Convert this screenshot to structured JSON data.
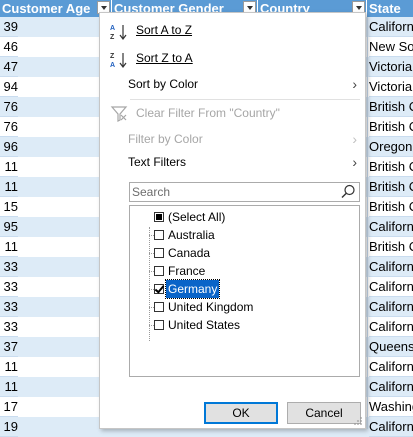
{
  "headers": {
    "customer_age": "Customer Age",
    "customer_gender": "Customer Gender",
    "country": "Country",
    "state": "State"
  },
  "rows": [
    {
      "age": "39",
      "state": "California"
    },
    {
      "age": "46",
      "state": "New South Wales"
    },
    {
      "age": "47",
      "state": "Victoria"
    },
    {
      "age": "94",
      "state": "Victoria"
    },
    {
      "age": "76",
      "state": "British Columbia"
    },
    {
      "age": "76",
      "state": "British Columbia"
    },
    {
      "age": "96",
      "state": "Oregon"
    },
    {
      "age": "11",
      "state": "British Columbia"
    },
    {
      "age": "11",
      "state": "British Columbia"
    },
    {
      "age": "15",
      "state": "British Columbia"
    },
    {
      "age": "95",
      "state": "California"
    },
    {
      "age": "11",
      "state": "British Columbia"
    },
    {
      "age": "33",
      "state": "California"
    },
    {
      "age": "33",
      "state": "California"
    },
    {
      "age": "33",
      "state": "California"
    },
    {
      "age": "33",
      "state": "California"
    },
    {
      "age": "37",
      "state": "Queensland"
    },
    {
      "age": "11",
      "state": "California"
    },
    {
      "age": "11",
      "state": "California"
    },
    {
      "age": "17",
      "state": "Washington"
    },
    {
      "age": "19",
      "state": "California"
    }
  ],
  "menu": {
    "sort_az": "Sort A to Z",
    "sort_za": "Sort Z to A",
    "sort_by_color": "Sort by Color",
    "clear_filter": "Clear Filter From \"Country\"",
    "filter_by_color": "Filter by Color",
    "text_filters": "Text Filters",
    "search_placeholder": "Search",
    "ok_label": "OK",
    "cancel_label": "Cancel"
  },
  "filter_items": [
    {
      "label": "(Select All)",
      "state": "partial"
    },
    {
      "label": "Australia",
      "state": "unchecked"
    },
    {
      "label": "Canada",
      "state": "unchecked"
    },
    {
      "label": "France",
      "state": "unchecked"
    },
    {
      "label": "Germany",
      "state": "checked"
    },
    {
      "label": "United Kingdom",
      "state": "unchecked"
    },
    {
      "label": "United States",
      "state": "unchecked"
    }
  ],
  "colors": {
    "header_bg": "#5b9bd5",
    "band_row": "#ddebf7",
    "selection": "#0a64c8"
  }
}
